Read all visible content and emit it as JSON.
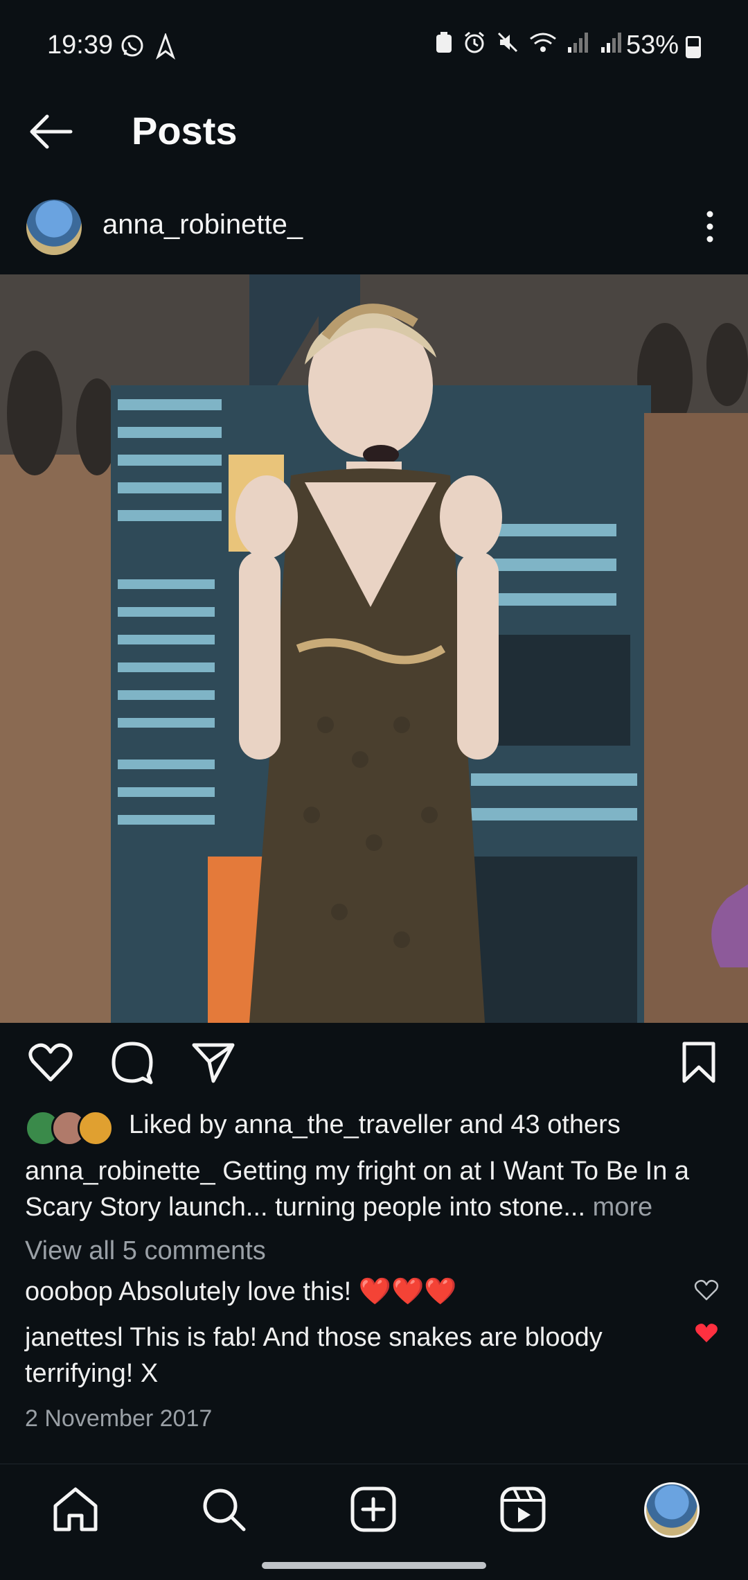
{
  "status_bar": {
    "time": "19:39",
    "battery": "53%",
    "left_icons": [
      "whatsapp-icon",
      "navigation-icon"
    ],
    "right_icons": [
      "vpn-icon",
      "alarm-icon",
      "mute-icon",
      "wifi-icon",
      "signal-icon",
      "signal-icon"
    ],
    "battery_level": 0.53
  },
  "header": {
    "title": "Posts",
    "back_icon": "arrow-left-icon"
  },
  "post": {
    "username": "anna_robinette_",
    "more_icon": "more-vertical-icon",
    "photo_icon": "photo-image",
    "likes_text": "Liked by anna_the_traveller and 43 others",
    "caption_user": "anna_robinette_",
    "caption_text": "Getting my fright on at I Want To Be In a Scary Story launch... turning people into stone...",
    "more_label": " more",
    "view_comments": "View all 5 comments",
    "comments": [
      {
        "user": "ooobop",
        "text": "Absolutely love this! ❤️❤️❤️",
        "liked": false
      },
      {
        "user": "janettesl",
        "text": "This is fab! And those snakes are bloody terrifying! X",
        "liked": true
      }
    ],
    "date": "2 November 2017"
  },
  "colors": {
    "background": "#0b1014",
    "like_red": "#ff3040",
    "muted_text": "#9aa0a6"
  }
}
